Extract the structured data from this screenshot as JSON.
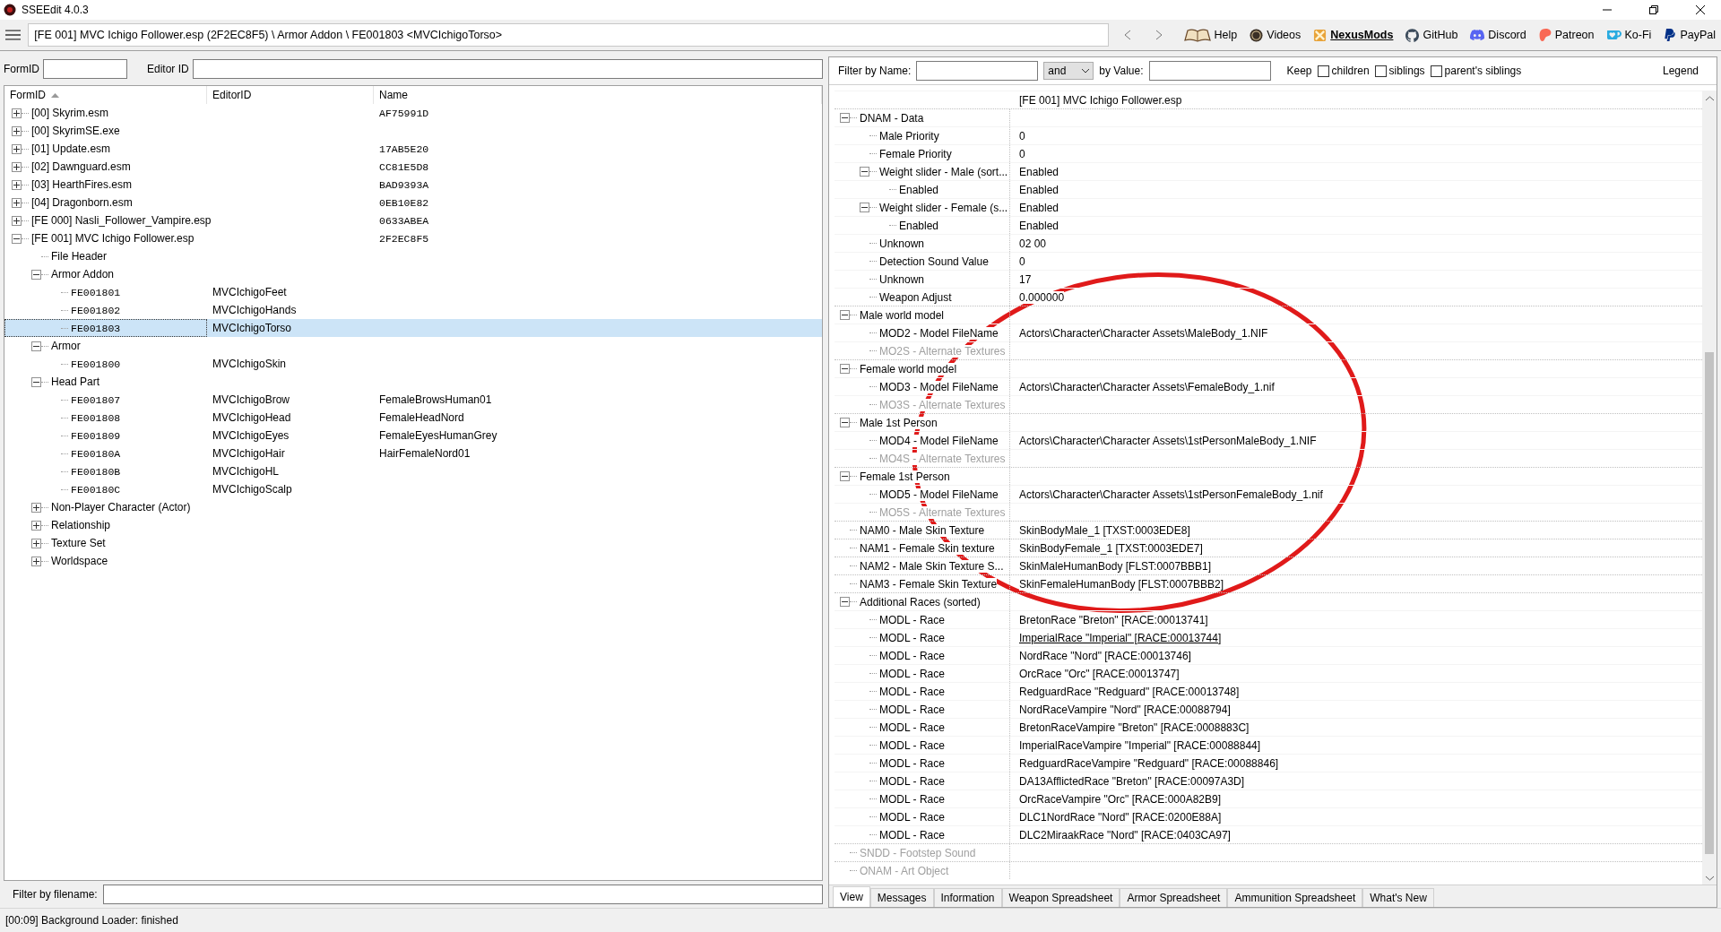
{
  "window": {
    "title": "SSEEdit 4.0.3"
  },
  "toolbar": {
    "breadcrumb": "[FE 001] MVC Ichigo Follower.esp (2F2EC8F5) \\ Armor Addon \\ FE001803 <MVCIchigoTorso>",
    "links": [
      {
        "kind": "book",
        "label": "Help",
        "emphasized": false
      },
      {
        "kind": "coin",
        "label": "Videos",
        "emphasized": false
      },
      {
        "kind": "nexus",
        "label": "NexusMods",
        "emphasized": true
      },
      {
        "kind": "github",
        "label": "GitHub",
        "emphasized": false
      },
      {
        "kind": "discord",
        "label": "Discord",
        "emphasized": false
      },
      {
        "kind": "patreon",
        "label": "Patreon",
        "emphasized": false
      },
      {
        "kind": "kofi",
        "label": "Ko-Fi",
        "emphasized": false
      },
      {
        "kind": "paypal",
        "label": "PayPal",
        "emphasized": false
      }
    ]
  },
  "left": {
    "formid_label": "FormID",
    "editorid_label": "Editor ID",
    "columns": [
      {
        "label": "FormID",
        "sorted": true
      },
      {
        "label": "EditorID",
        "sorted": false
      },
      {
        "label": "Name",
        "sorted": false
      }
    ],
    "tree": [
      {
        "formid": "[00] Skyrim.esm",
        "name": "AF75991D",
        "expanded": false,
        "selected": false
      },
      {
        "formid": "[00] SkyrimSE.exe",
        "expanded": false,
        "selected": false
      },
      {
        "formid": "[01] Update.esm",
        "name": "17AB5E20",
        "expanded": false,
        "selected": false
      },
      {
        "formid": "[02] Dawnguard.esm",
        "name": "CC81E5D8",
        "expanded": false,
        "selected": false
      },
      {
        "formid": "[03] HearthFires.esm",
        "name": "BAD9393A",
        "expanded": false,
        "selected": false
      },
      {
        "formid": "[04] Dragonborn.esm",
        "name": "0EB10E82",
        "expanded": false,
        "selected": false
      },
      {
        "formid": "[FE 000] Nasli_Follower_Vampire.esp",
        "name": "0633ABEA",
        "expanded": false,
        "selected": false
      },
      {
        "formid": "[FE 001] MVC Ichigo Follower.esp",
        "name": "2F2EC8F5",
        "expanded": true,
        "selected": false,
        "children": [
          {
            "formid": "File Header",
            "selected": false
          },
          {
            "formid": "Armor Addon",
            "expanded": true,
            "selected": false,
            "children": [
              {
                "formid": "FE001801",
                "editorid": "MVCIchigoFeet",
                "mono": true,
                "selected": false
              },
              {
                "formid": "FE001802",
                "editorid": "MVCIchigoHands",
                "mono": true,
                "selected": false
              },
              {
                "formid": "FE001803",
                "editorid": "MVCIchigoTorso",
                "mono": true,
                "selected": true
              }
            ]
          },
          {
            "formid": "Armor",
            "expanded": true,
            "selected": false,
            "children": [
              {
                "formid": "FE001800",
                "editorid": "MVCIchigoSkin",
                "mono": true,
                "selected": false
              }
            ]
          },
          {
            "formid": "Head Part",
            "expanded": true,
            "selected": false,
            "children": [
              {
                "formid": "FE001807",
                "editorid": "MVCIchigoBrow",
                "name": "FemaleBrowsHuman01",
                "mono": true,
                "selected": false
              },
              {
                "formid": "FE001808",
                "editorid": "MVCIchigoHead",
                "name": "FemaleHeadNord",
                "mono": true,
                "selected": false
              },
              {
                "formid": "FE001809",
                "editorid": "MVCIchigoEyes",
                "name": "FemaleEyesHumanGrey",
                "mono": true,
                "selected": false
              },
              {
                "formid": "FE00180A",
                "editorid": "MVCIchigoHair",
                "name": "HairFemaleNord01",
                "mono": true,
                "selected": false
              },
              {
                "formid": "FE00180B",
                "editorid": "MVCIchigoHL",
                "mono": true,
                "selected": false
              },
              {
                "formid": "FE00180C",
                "editorid": "MVCIchigoScalp",
                "mono": true,
                "selected": false
              }
            ]
          },
          {
            "formid": "Non-Player Character (Actor)",
            "expanded": false,
            "selected": false
          },
          {
            "formid": "Relationship",
            "expanded": false,
            "selected": false
          },
          {
            "formid": "Texture Set",
            "expanded": false,
            "selected": false
          },
          {
            "formid": "Worldspace",
            "expanded": false,
            "selected": false
          }
        ]
      }
    ],
    "filter_label": "Filter by filename:"
  },
  "right": {
    "filter_name_label": "Filter by Name:",
    "operator": "and",
    "value_label": "by Value:",
    "keep_label": "Keep",
    "keep_options": [
      {
        "label": "children",
        "checked": false
      },
      {
        "label": "siblings",
        "checked": false
      },
      {
        "label": "parent's siblings",
        "checked": false
      }
    ],
    "legend": "Legend",
    "record_header": "[FE 001] MVC Ichigo Follower.esp",
    "tree": [
      {
        "label": "DNAM - Data",
        "expanded": true,
        "disabled": false,
        "children": [
          {
            "label": "Male Priority",
            "value": "0",
            "disabled": false
          },
          {
            "label": "Female Priority",
            "value": "0",
            "disabled": false
          },
          {
            "label": "Weight slider - Male (sort...",
            "value": "Enabled",
            "expanded": true,
            "disabled": false,
            "children": [
              {
                "label": "Enabled",
                "value": "Enabled",
                "disabled": false
              }
            ]
          },
          {
            "label": "Weight slider - Female (s...",
            "value": "Enabled",
            "expanded": true,
            "disabled": false,
            "children": [
              {
                "label": "Enabled",
                "value": "Enabled",
                "disabled": false
              }
            ]
          },
          {
            "label": "Unknown",
            "value": "02 00",
            "disabled": false
          },
          {
            "label": "Detection Sound Value",
            "value": "0",
            "disabled": false
          },
          {
            "label": "Unknown",
            "value": "17",
            "disabled": false
          },
          {
            "label": "Weapon Adjust",
            "value": "0.000000",
            "disabled": false
          }
        ]
      },
      {
        "label": "Male world model",
        "expanded": true,
        "disabled": false,
        "children": [
          {
            "label": "MOD2 - Model FileName",
            "value": "Actors\\Character\\Character Assets\\MaleBody_1.NIF",
            "disabled": false
          },
          {
            "label": "MO2S - Alternate Textures",
            "disabled": true
          }
        ]
      },
      {
        "label": "Female world model",
        "expanded": true,
        "disabled": false,
        "children": [
          {
            "label": "MOD3 - Model FileName",
            "value": "Actors\\Character\\Character Assets\\FemaleBody_1.nif",
            "disabled": false
          },
          {
            "label": "MO3S - Alternate Textures",
            "disabled": true
          }
        ]
      },
      {
        "label": "Male 1st Person",
        "expanded": true,
        "disabled": false,
        "children": [
          {
            "label": "MOD4 - Model FileName",
            "value": "Actors\\Character\\Character Assets\\1stPersonMaleBody_1.NIF",
            "disabled": false
          },
          {
            "label": "MO4S - Alternate Textures",
            "disabled": true
          }
        ]
      },
      {
        "label": "Female 1st Person",
        "expanded": true,
        "disabled": false,
        "children": [
          {
            "label": "MOD5 - Model FileName",
            "value": "Actors\\Character\\Character Assets\\1stPersonFemaleBody_1.nif",
            "disabled": false
          },
          {
            "label": "MO5S - Alternate Textures",
            "disabled": true
          }
        ]
      },
      {
        "label": "NAM0 - Male Skin Texture",
        "value": "SkinBodyMale_1 [TXST:0003EDE8]",
        "disabled": false
      },
      {
        "label": "NAM1 - Female Skin texture",
        "value": "SkinBodyFemale_1 [TXST:0003EDE7]",
        "disabled": false
      },
      {
        "label": "NAM2 - Male Skin Texture S...",
        "value": "SkinMaleHumanBody [FLST:0007BBB1]",
        "disabled": false
      },
      {
        "label": "NAM3 - Female Skin Texture",
        "value": "SkinFemaleHumanBody [FLST:0007BBB2]",
        "disabled": false
      },
      {
        "label": "Additional Races (sorted)",
        "expanded": true,
        "disabled": false,
        "children": [
          {
            "label": "MODL - Race",
            "value": "BretonRace \"Breton\" [RACE:00013741]",
            "disabled": false
          },
          {
            "label": "MODL - Race",
            "value": "ImperialRace \"Imperial\" [RACE:00013744]",
            "underlined": true,
            "disabled": false
          },
          {
            "label": "MODL - Race",
            "value": "NordRace \"Nord\" [RACE:00013746]",
            "disabled": false
          },
          {
            "label": "MODL - Race",
            "value": "OrcRace \"Orc\" [RACE:00013747]",
            "disabled": false
          },
          {
            "label": "MODL - Race",
            "value": "RedguardRace \"Redguard\" [RACE:00013748]",
            "disabled": false
          },
          {
            "label": "MODL - Race",
            "value": "NordRaceVampire \"Nord\" [RACE:00088794]",
            "disabled": false
          },
          {
            "label": "MODL - Race",
            "value": "BretonRaceVampire \"Breton\" [RACE:0008883C]",
            "disabled": false
          },
          {
            "label": "MODL - Race",
            "value": "ImperialRaceVampire \"Imperial\" [RACE:00088844]",
            "disabled": false
          },
          {
            "label": "MODL - Race",
            "value": "RedguardRaceVampire \"Redguard\" [RACE:00088846]",
            "disabled": false
          },
          {
            "label": "MODL - Race",
            "value": "DA13AfflictedRace \"Breton\" [RACE:00097A3D]",
            "disabled": false
          },
          {
            "label": "MODL - Race",
            "value": "OrcRaceVampire \"Orc\" [RACE:000A82B9]",
            "disabled": false
          },
          {
            "label": "MODL - Race",
            "value": "DLC1NordRace \"Nord\" [RACE:0200E88A]",
            "disabled": false
          },
          {
            "label": "MODL - Race",
            "value": "DLC2MiraakRace \"Nord\" [RACE:0403CA97]",
            "disabled": false
          }
        ]
      },
      {
        "label": "SNDD - Footstep Sound",
        "disabled": true
      },
      {
        "label": "ONAM - Art Object",
        "disabled": true
      }
    ],
    "tabs": [
      {
        "label": "View",
        "selected": true
      },
      {
        "label": "Messages",
        "selected": false
      },
      {
        "label": "Information",
        "selected": false
      },
      {
        "label": "Weapon Spreadsheet",
        "selected": false
      },
      {
        "label": "Armor Spreadsheet",
        "selected": false
      },
      {
        "label": "Ammunition Spreadsheet",
        "selected": false
      },
      {
        "label": "What's New",
        "selected": false
      }
    ]
  },
  "status": "[00:09] Background Loader: finished"
}
